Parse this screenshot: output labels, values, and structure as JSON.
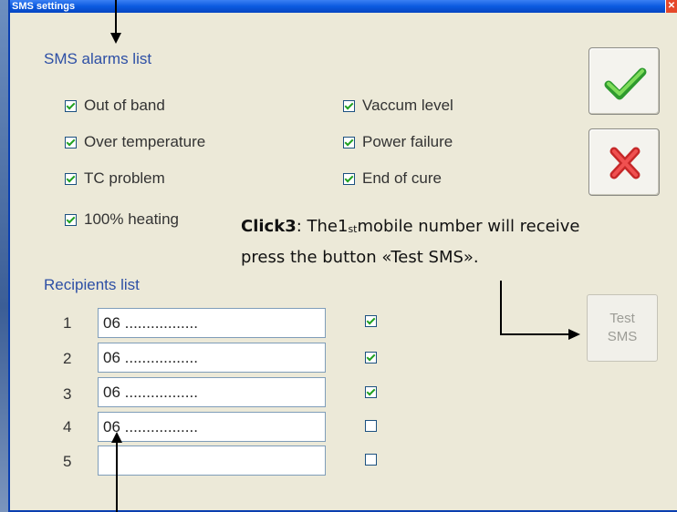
{
  "window": {
    "title": "SMS settings",
    "close_label": "✕"
  },
  "alarms": {
    "title": "SMS alarms list",
    "items": [
      {
        "label": "Out of band",
        "checked": true
      },
      {
        "label": "Over temperature",
        "checked": true
      },
      {
        "label": "TC problem",
        "checked": true
      },
      {
        "label": "100% heating",
        "checked": true
      },
      {
        "label": "Vaccum level",
        "checked": true
      },
      {
        "label": "Power failure",
        "checked": true
      },
      {
        "label": "End of cure",
        "checked": true
      }
    ]
  },
  "buttons": {
    "ok_icon": "check-icon",
    "cancel_icon": "x-icon",
    "test_line1": "Test",
    "test_line2": "SMS"
  },
  "recipients": {
    "title": "Recipients list",
    "rows": [
      {
        "num": "1",
        "value": "06 .................",
        "checked": true
      },
      {
        "num": "2",
        "value": "06 .................",
        "checked": true
      },
      {
        "num": "3",
        "value": "06 .................",
        "checked": true
      },
      {
        "num": "4",
        "value": "06 .................",
        "checked": false
      },
      {
        "num": "5",
        "value": "",
        "checked": false
      }
    ]
  },
  "annotation": {
    "bold": "Click3",
    "text1": ": The1",
    "sup": "st",
    "text2": "mobile number will receive",
    "line2": "press the button «Test SMS»."
  },
  "colors": {
    "title_bar": "#0b5ae0",
    "group_title": "#2d4fa5",
    "check": "#21a121",
    "cancel": "#d63030"
  }
}
